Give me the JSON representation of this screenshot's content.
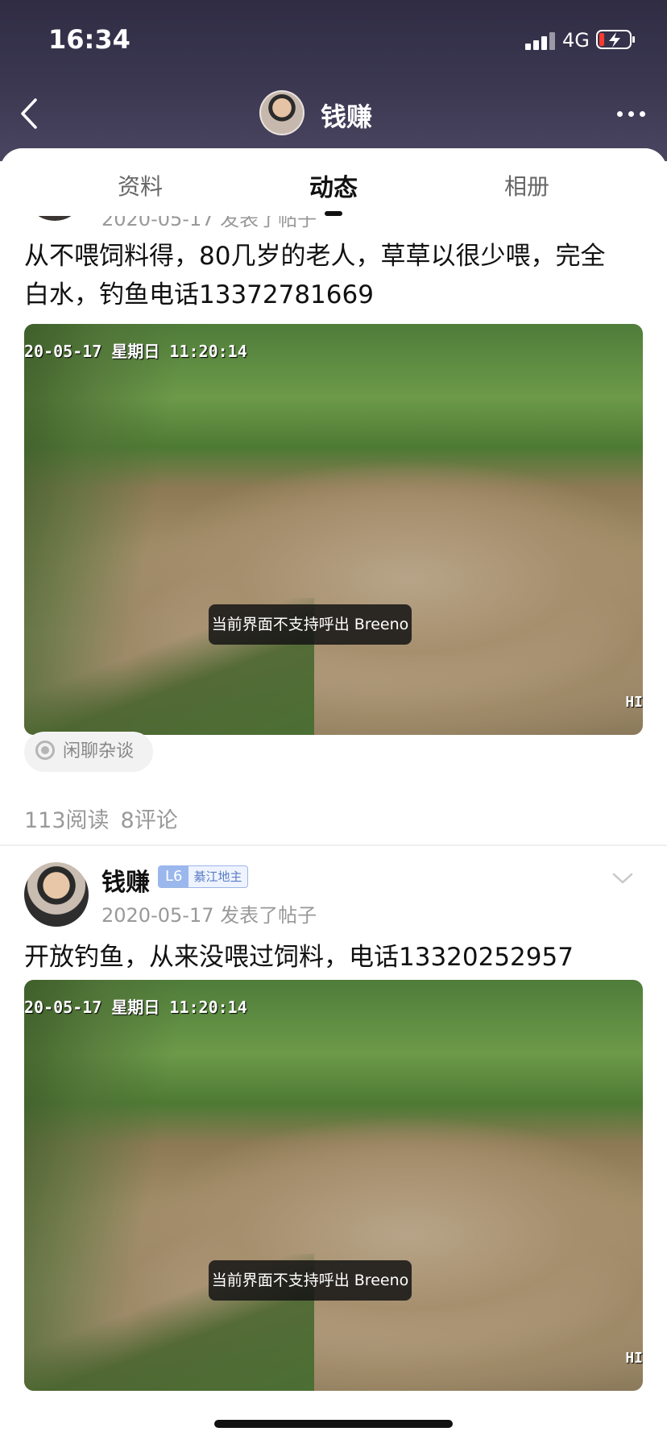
{
  "status_bar": {
    "time": "16:34",
    "network": "4G"
  },
  "nav": {
    "title": "钱赚"
  },
  "tabs": [
    {
      "label": "资料"
    },
    {
      "label": "动态"
    },
    {
      "label": "相册"
    }
  ],
  "posts": [
    {
      "meta_peek": "2020-05-17 发表了帖子",
      "text_line1": "从不喂饲料得，80几岁的老人，草草以很少喂，完全",
      "text_line2": "白水，钓鱼电话13372781669",
      "image_timestamp": "20-05-17  星期日  11:20:14",
      "image_corner": "HI",
      "toast": "当前界面不支持呼出 Breeno",
      "topic": "闲聊杂谈",
      "reads": "113阅读",
      "comments": "8评论"
    },
    {
      "author": "钱赚",
      "level": "L6",
      "level_title": "綦江地主",
      "meta": "2020-05-17 发表了帖子",
      "text": "开放钓鱼，从来没喂过饲料，电话13320252957",
      "image_timestamp": "20-05-17  星期日  11:20:14",
      "image_corner": "HI",
      "toast": "当前界面不支持呼出 Breeno"
    }
  ],
  "colors": {
    "header_bg": "#3c3852",
    "accent_level": "#9ab7ee"
  }
}
